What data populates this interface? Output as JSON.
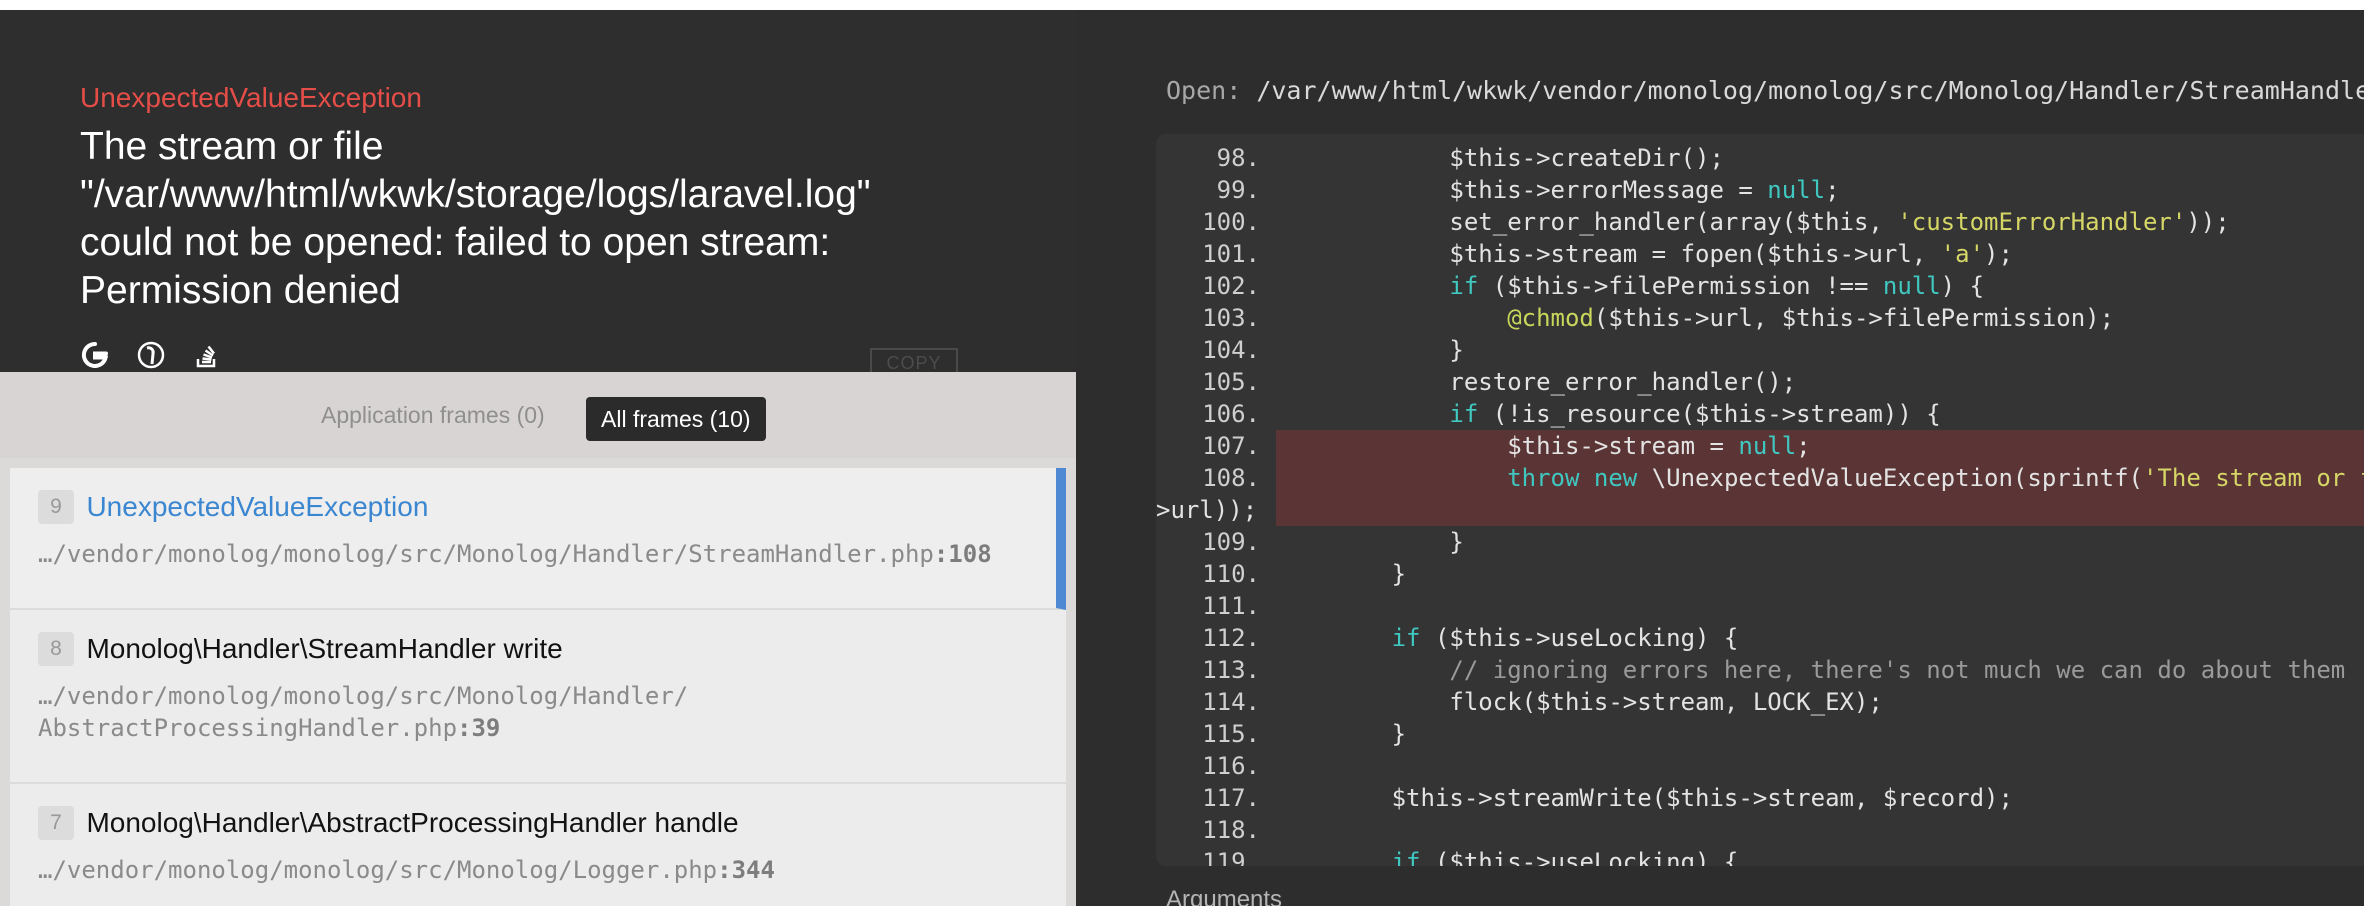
{
  "exception": {
    "type": "UnexpectedValueException",
    "message_lines": [
      "The stream or file",
      "\"/var/www/html/wkwk/storage/logs/laravel.log\"",
      "could not be opened: failed to open stream:",
      "Permission denied"
    ],
    "search_icons": [
      "google-icon",
      "duckduckgo-icon",
      "stackoverflow-icon"
    ],
    "copy_label": "COPY"
  },
  "frames": {
    "tabs": {
      "application": "Application frames (0)",
      "all": "All frames (10)"
    },
    "items": [
      {
        "num": "9",
        "class": "UnexpectedValueException",
        "file_lines": [
          "…/vendor/monolog/monolog/src/Monolog/Handler/StreamHandler.php"
        ],
        "line": ":108",
        "active": true
      },
      {
        "num": "8",
        "class": "Monolog\\Handler\\StreamHandler write",
        "file_lines": [
          "…/vendor/monolog/monolog/src/Monolog/Handler/",
          "AbstractProcessingHandler.php"
        ],
        "line": ":39",
        "active": false
      },
      {
        "num": "7",
        "class": "Monolog\\Handler\\AbstractProcessingHandler handle",
        "file_lines": [
          "…/vendor/monolog/monolog/src/Monolog/Logger.php"
        ],
        "line": ":344",
        "active": false
      }
    ]
  },
  "code": {
    "open_label": "Open:",
    "open_path": "/var/www/html/wkwk/vendor/monolog/monolog/src/Monolog/Handler/StreamHandler.php",
    "highlight_lines": [
      "107.",
      "108.",
      ""
    ],
    "lines": [
      {
        "n": "98.",
        "parts": [
          [
            "",
            "            $this->createDir();"
          ]
        ]
      },
      {
        "n": "99.",
        "parts": [
          [
            "",
            "            $this->errorMessage = "
          ],
          [
            "kw",
            "null"
          ],
          [
            "",
            ";"
          ]
        ]
      },
      {
        "n": "100.",
        "parts": [
          [
            "",
            "            set_error_handler(array($this, "
          ],
          [
            "str",
            "'customErrorHandler'"
          ],
          [
            "",
            "));"
          ]
        ]
      },
      {
        "n": "101.",
        "parts": [
          [
            "",
            "            $this->stream = fopen($this->url, "
          ],
          [
            "str",
            "'a'"
          ],
          [
            "",
            ");"
          ]
        ]
      },
      {
        "n": "102.",
        "parts": [
          [
            "",
            "            "
          ],
          [
            "kw",
            "if"
          ],
          [
            "",
            " ($this->filePermission !== "
          ],
          [
            "kw",
            "null"
          ],
          [
            "",
            ") {"
          ]
        ]
      },
      {
        "n": "103.",
        "parts": [
          [
            "",
            "                "
          ],
          [
            "fn",
            "@chmod"
          ],
          [
            "",
            "($this->url, $this->filePermission);"
          ]
        ]
      },
      {
        "n": "104.",
        "parts": [
          [
            "",
            "            }"
          ]
        ]
      },
      {
        "n": "105.",
        "parts": [
          [
            "",
            "            restore_error_handler();"
          ]
        ]
      },
      {
        "n": "106.",
        "parts": [
          [
            "",
            "            "
          ],
          [
            "kw",
            "if"
          ],
          [
            "",
            " (!is_resource($this->stream)) {"
          ]
        ]
      },
      {
        "n": "107.",
        "parts": [
          [
            "",
            "                $this->stream = "
          ],
          [
            "kw",
            "null"
          ],
          [
            "",
            ";"
          ]
        ]
      },
      {
        "n": "108.",
        "parts": [
          [
            "",
            "                "
          ],
          [
            "kw",
            "throw"
          ],
          [
            "",
            " "
          ],
          [
            "kw",
            "new"
          ],
          [
            "",
            " \\UnexpectedValueException(sprintf("
          ],
          [
            "str",
            "'The stream or file \"%s\"'"
          ]
        ]
      },
      {
        "n": "",
        "parts": [
          [
            "",
            ">url));"
          ]
        ]
      },
      {
        "n": "109.",
        "parts": [
          [
            "",
            "            }"
          ]
        ]
      },
      {
        "n": "110.",
        "parts": [
          [
            "",
            "        }"
          ]
        ]
      },
      {
        "n": "111.",
        "parts": [
          [
            "",
            ""
          ]
        ]
      },
      {
        "n": "112.",
        "parts": [
          [
            "",
            "        "
          ],
          [
            "kw",
            "if"
          ],
          [
            "",
            " ($this->useLocking) {"
          ]
        ]
      },
      {
        "n": "113.",
        "parts": [
          [
            "cm",
            "            // ignoring errors here, there's not much we can do about them"
          ]
        ]
      },
      {
        "n": "114.",
        "parts": [
          [
            "",
            "            flock($this->stream, LOCK_EX);"
          ]
        ]
      },
      {
        "n": "115.",
        "parts": [
          [
            "",
            "        }"
          ]
        ]
      },
      {
        "n": "116.",
        "parts": [
          [
            "",
            ""
          ]
        ]
      },
      {
        "n": "117.",
        "parts": [
          [
            "",
            "        $this->streamWrite($this->stream, $record);"
          ]
        ]
      },
      {
        "n": "118.",
        "parts": [
          [
            "",
            ""
          ]
        ]
      },
      {
        "n": "119.",
        "parts": [
          [
            "",
            "        "
          ],
          [
            "kw",
            "if"
          ],
          [
            "",
            " ($this->useLocking) {"
          ]
        ]
      }
    ]
  },
  "arguments_label": "Arguments",
  "colors": {
    "exception_type": "#e54e48",
    "active_frame_accent": "#4f88d3",
    "highlight_row": "#5b3535",
    "keyword": "#3fc7c0",
    "string": "#d6d667"
  }
}
